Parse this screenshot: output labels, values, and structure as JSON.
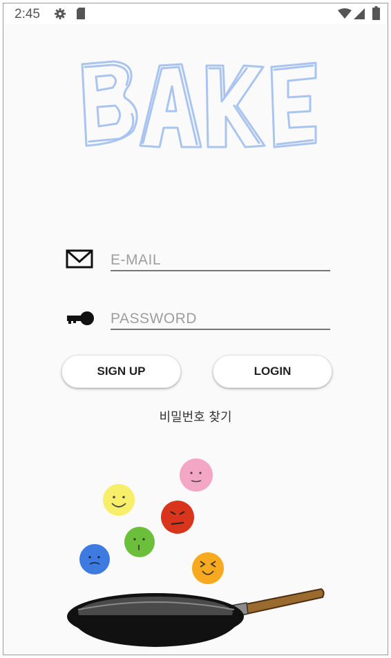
{
  "status_bar": {
    "time": "2:45",
    "icons": [
      "gear-icon",
      "sd-card-icon",
      "wifi-icon",
      "signal-icon",
      "battery-icon"
    ]
  },
  "logo": {
    "text": "BAKE",
    "color": "#a9c4ef"
  },
  "email": {
    "placeholder": "E-MAIL",
    "value": "",
    "icon": "mail-icon"
  },
  "password": {
    "placeholder": "PASSWORD",
    "value": "",
    "icon": "key-icon"
  },
  "buttons": {
    "sign_up": "SIGN UP",
    "login": "LOGIN"
  },
  "find_password": "비밀번호 찾기",
  "illustration": {
    "faces": [
      {
        "name": "pink-face-icon",
        "color": "#f4a7c4"
      },
      {
        "name": "yellow-face-icon",
        "color": "#f7ef6a"
      },
      {
        "name": "red-face-icon",
        "color": "#d9341c"
      },
      {
        "name": "green-face-icon",
        "color": "#6cbf3b"
      },
      {
        "name": "blue-face-icon",
        "color": "#3d7be0"
      },
      {
        "name": "orange-face-icon",
        "color": "#f7a91f"
      }
    ],
    "pan": "frying-pan-icon"
  }
}
